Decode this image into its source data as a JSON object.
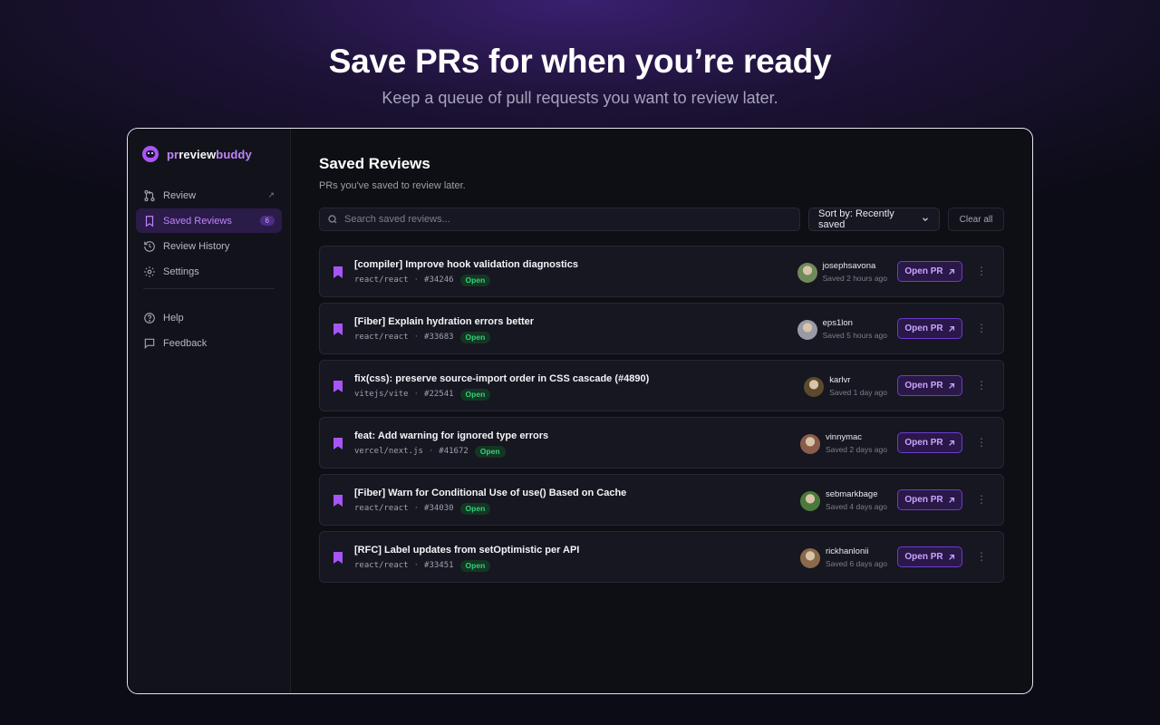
{
  "hero": {
    "title": "Save PRs for when you’re ready",
    "subtitle": "Keep a queue of pull requests you want to review later."
  },
  "brand": {
    "part1": "pr",
    "part2": "review",
    "part3": "buddy"
  },
  "sidebar": {
    "items": [
      {
        "label": "Review",
        "icon": "git-pull-request-icon",
        "external": "↗"
      },
      {
        "label": "Saved Reviews",
        "icon": "bookmark-icon",
        "badge": "6"
      },
      {
        "label": "Review History",
        "icon": "history-icon"
      },
      {
        "label": "Settings",
        "icon": "gear-icon"
      }
    ],
    "bottom": [
      {
        "label": "Help",
        "icon": "help-circle-icon"
      },
      {
        "label": "Feedback",
        "icon": "message-icon"
      }
    ]
  },
  "main": {
    "title": "Saved Reviews",
    "subtitle": "PRs you've saved to review later.",
    "search_placeholder": "Search saved reviews...",
    "sort_label": "Sort by: Recently saved",
    "clear_label": "Clear all",
    "open_label": "Open PR"
  },
  "reviews": [
    {
      "title": "[compiler] Improve hook validation diagnostics",
      "repo": "react/react",
      "number": "#34246",
      "status": "Open",
      "user": "josephsavona",
      "saved": "Saved 2 hours ago",
      "avatar_color": "#6f8a5a"
    },
    {
      "title": "[Fiber] Explain hydration errors better",
      "repo": "react/react",
      "number": "#33683",
      "status": "Open",
      "user": "eps1lon",
      "saved": "Saved 5 hours ago",
      "avatar_color": "#9a9aa6"
    },
    {
      "title": "fix(css): preserve source-import order in CSS cascade (#4890)",
      "repo": "vitejs/vite",
      "number": "#22541",
      "status": "Open",
      "user": "karlvr",
      "saved": "Saved 1 day ago",
      "avatar_color": "#5c4a2c"
    },
    {
      "title": "feat: Add warning for ignored type errors",
      "repo": "vercel/next.js",
      "number": "#41672",
      "status": "Open",
      "user": "vinnymac",
      "saved": "Saved 2 days ago",
      "avatar_color": "#8a5c4a"
    },
    {
      "title": "[Fiber] Warn for Conditional Use of use() Based on Cache",
      "repo": "react/react",
      "number": "#34030",
      "status": "Open",
      "user": "sebmarkbage",
      "saved": "Saved 4 days ago",
      "avatar_color": "#4a7a3a"
    },
    {
      "title": "[RFC] Label updates from setOptimistic per API",
      "repo": "react/react",
      "number": "#33451",
      "status": "Open",
      "user": "rickhanlonii",
      "saved": "Saved 6 days ago",
      "avatar_color": "#8a6a4a"
    }
  ]
}
